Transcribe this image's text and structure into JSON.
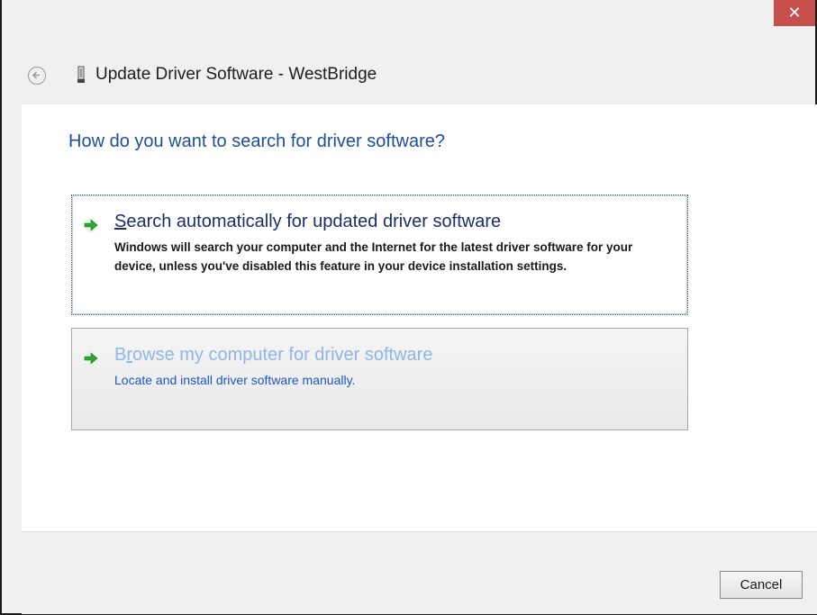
{
  "window": {
    "title": "Update Driver Software - WestBridge",
    "close_glyph": "✕"
  },
  "page": {
    "heading": "How do you want to search for driver software?"
  },
  "options": [
    {
      "accesskey": "S",
      "title_rest": "earch automatically for updated driver software",
      "description": "Windows will search your computer and the Internet for the latest driver software for your device, unless you've disabled this feature in your device installation settings.",
      "icon": "green-arrow-icon"
    },
    {
      "title_pre": "B",
      "accesskey": "r",
      "title_rest": "owse my computer for driver software",
      "description": "Locate and install driver software manually.",
      "icon": "green-arrow-icon"
    }
  ],
  "footer": {
    "cancel_label": "Cancel"
  },
  "colors": {
    "heading": "#1f4e9c",
    "close_button": "#c7504d",
    "hover_link": "#8fb6e6"
  }
}
